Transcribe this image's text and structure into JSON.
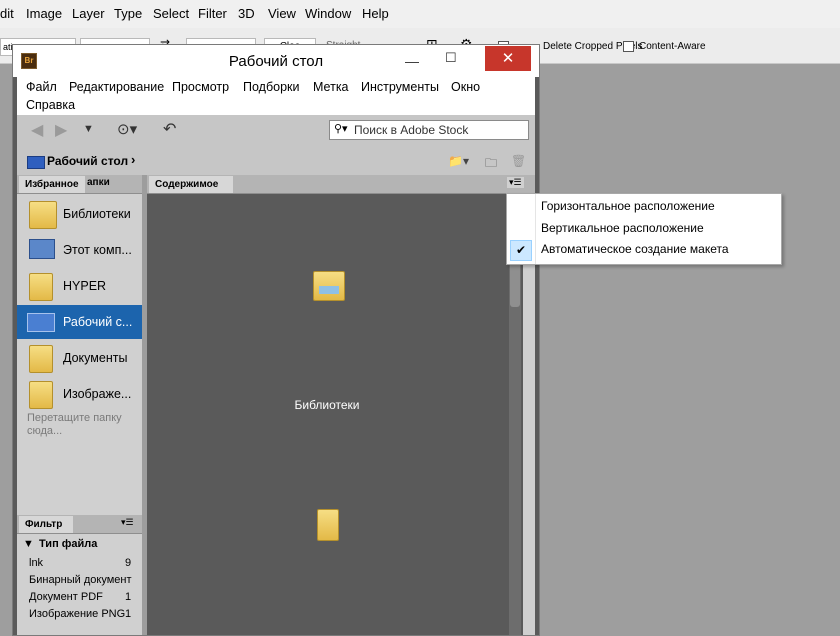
{
  "ps_menu": [
    "dit",
    "Image",
    "Layer",
    "Type",
    "Select",
    "Filter",
    "3D",
    "View",
    "Window",
    "Help"
  ],
  "ps_options": {
    "field1": "ation",
    "button_partial": "Clea",
    "straighten_partial": "Straight",
    "delete_cropped": "Delete Cropped Pixels",
    "content_aware": "Content-Aware"
  },
  "bridge": {
    "logo": "Br",
    "title": "Рабочий стол",
    "close": "✕",
    "menu": [
      "Файл",
      "Редактирование",
      "Просмотр",
      "Подборки",
      "Метка",
      "Инструменты",
      "Окно",
      "Справка"
    ],
    "search_placeholder": "Поиск в Adobe Stock",
    "path": "Рабочий стол",
    "left_tabs": [
      "Избранное",
      "апки"
    ],
    "favorites": [
      "Библиотеки",
      "Этот комп...",
      "HYPER",
      "Рабочий с...",
      "Документы",
      "Изображе..."
    ],
    "drag_hint": "Перетащите папку сюда...",
    "filter_tab": "Фильтр",
    "filter_header": "Тип файла",
    "filter_rows": [
      {
        "label": "lnk",
        "count": "9"
      },
      {
        "label": "Бинарный документ",
        "count": ""
      },
      {
        "label": "Документ PDF",
        "count": "1"
      },
      {
        "label": "Изображение PNG",
        "count": "1"
      }
    ],
    "content_tab": "Содержимое",
    "content_items": [
      "Библиотеки"
    ]
  },
  "context_menu": {
    "items": [
      "Горизонтальное расположение",
      "Вертикальное расположение",
      "Автоматическое создание макета"
    ],
    "checked_index": 2
  }
}
